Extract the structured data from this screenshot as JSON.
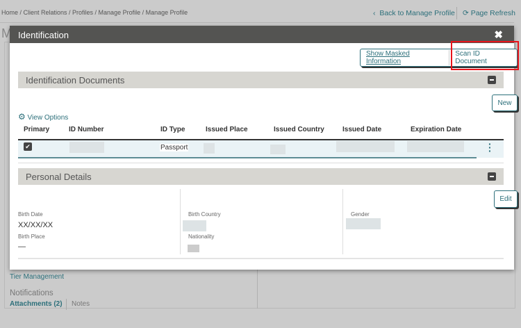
{
  "breadcrumb": "Home / Client Relations / Profiles / Manage Profile / Manage Profile",
  "back_link": "Back to Manage Profile",
  "refresh_link": "Page Refresh",
  "bg_page_initial": "M",
  "background": {
    "tier": "Tier Management",
    "notifications": "Notifications",
    "attachments": "Attachments (2)",
    "notes": "Notes"
  },
  "modal": {
    "title": "Identification",
    "show_masked": "Show Masked Information",
    "scan_id": "Scan ID Document",
    "id_docs_title": "Identification Documents",
    "new_label": "New",
    "view_options": "View Options",
    "columns": [
      "Primary",
      "ID Number",
      "ID Type",
      "Issued Place",
      "Issued Country",
      "Issued Date",
      "Expiration Date"
    ],
    "row": {
      "primary": true,
      "id_type": "Passport"
    },
    "personal_title": "Personal Details",
    "edit_label": "Edit",
    "fields": {
      "birth_date_label": "Birth Date",
      "birth_date": "XX/XX/XX",
      "birth_place_label": "Birth Place",
      "birth_place": "—",
      "birth_country_label": "Birth Country",
      "nationality_label": "Nationality",
      "gender_label": "Gender"
    }
  },
  "colors": {
    "accent": "#2c6f7a",
    "highlight": "#e8141b",
    "header": "#545452"
  }
}
